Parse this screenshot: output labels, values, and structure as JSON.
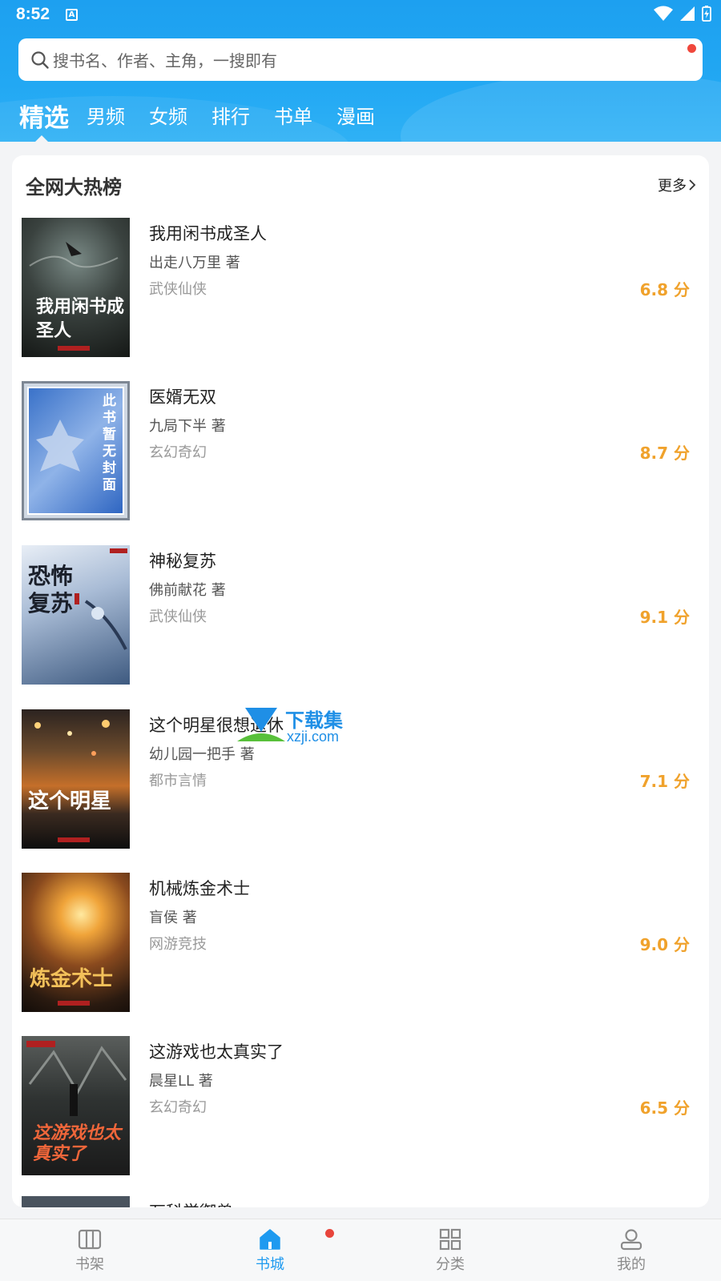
{
  "status_bar": {
    "time": "8:52",
    "notification_badge": "A"
  },
  "search": {
    "placeholder": "搜书名、作者、主角，一搜即有"
  },
  "tabs": [
    {
      "label": "精选",
      "active": true
    },
    {
      "label": "男频"
    },
    {
      "label": "女频"
    },
    {
      "label": "排行"
    },
    {
      "label": "书单"
    },
    {
      "label": "漫画"
    }
  ],
  "section": {
    "title": "全网大热榜",
    "more_label": "更多"
  },
  "books": [
    {
      "title": "我用闲书成圣人",
      "author": "出走八万里 著",
      "genre": "武侠仙侠",
      "score": "6.8 分",
      "cover_text": "我用闲书成圣人"
    },
    {
      "title": "医婿无双",
      "author": "九局下半 著",
      "genre": "玄幻奇幻",
      "score": "8.7 分",
      "cover_text": "此书暂无封面"
    },
    {
      "title": "神秘复苏",
      "author": "佛前献花 著",
      "genre": "武侠仙侠",
      "score": "9.1 分",
      "cover_text": "恐怖复苏"
    },
    {
      "title": "这个明星很想退休",
      "author": "幼儿园一把手 著",
      "genre": "都市言情",
      "score": "7.1 分",
      "cover_text": "这个明星"
    },
    {
      "title": "机械炼金术士",
      "author": "盲侯 著",
      "genre": "网游竞技",
      "score": "9.0 分",
      "cover_text": "炼金术士"
    },
    {
      "title": "这游戏也太真实了",
      "author": "晨星LL 著",
      "genre": "玄幻奇幻",
      "score": "6.5 分",
      "cover_text": "这游戏也太真实了"
    },
    {
      "title": "万科学御兽",
      "author": "",
      "genre": "",
      "score": "",
      "cover_text": ""
    }
  ],
  "watermark": {
    "line1": "下载集",
    "line2": "xzji.com"
  },
  "bottom_nav": [
    {
      "label": "书架",
      "icon": "bookshelf-icon"
    },
    {
      "label": "书城",
      "icon": "bookstore-icon",
      "active": true
    },
    {
      "label": "分类",
      "icon": "category-icon"
    },
    {
      "label": "我的",
      "icon": "profile-icon"
    }
  ],
  "colors": {
    "header_blue": "#1da0f0",
    "accent_blue": "#1e9af0",
    "score_orange": "#f0a22c",
    "badge_red": "#e8453c"
  }
}
